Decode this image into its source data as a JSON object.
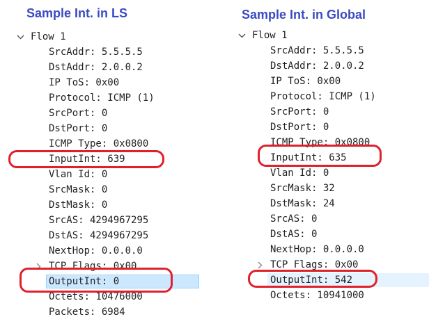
{
  "left": {
    "caption": "Sample Int. in LS",
    "flow_label": "Flow 1",
    "rows": [
      "SrcAddr: 5.5.5.5",
      "DstAddr: 2.0.0.2",
      "IP ToS: 0x00",
      "Protocol: ICMP (1)",
      "SrcPort: 0",
      "DstPort: 0",
      "ICMP Type: 0x0800",
      "InputInt: 639",
      "Vlan Id: 0",
      "SrcMask: 0",
      "DstMask: 0",
      "SrcAS: 4294967295",
      "DstAS: 4294967295",
      "NextHop: 0.0.0.0",
      "TCP Flags: 0x00",
      "OutputInt: 0",
      "Octets: 10476000",
      "Packets: 6984"
    ]
  },
  "right": {
    "caption": "Sample Int. in Global",
    "flow_label": "Flow 1",
    "rows": [
      "SrcAddr: 5.5.5.5",
      "DstAddr: 2.0.0.2",
      "IP ToS: 0x00",
      "Protocol: ICMP (1)",
      "SrcPort: 0",
      "DstPort: 0",
      "ICMP Type: 0x0800",
      "InputInt: 635",
      "Vlan Id: 0",
      "SrcMask: 32",
      "DstMask: 24",
      "SrcAS: 0",
      "DstAS: 0",
      "NextHop: 0.0.0.0",
      "TCP Flags: 0x00",
      "OutputInt: 542",
      "Octets: 10941000"
    ]
  },
  "colors": {
    "caption": "#3a4bc2",
    "highlight": "#e0202a",
    "selection": "#cce8ff"
  },
  "icons": {
    "expanded": "chevron-down-icon",
    "collapsed": "chevron-right-icon"
  }
}
